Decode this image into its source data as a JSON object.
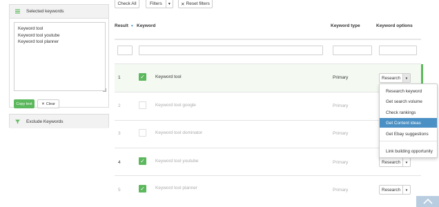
{
  "sidebar": {
    "selected_title": "Selected keywords",
    "selected_keywords_text": "Keyword tool\nKeyword tool youtube\nKeyword tool planner",
    "copy_label": "Copy text",
    "clear_label": "Clear",
    "exclude_title": "Exclude Keywords"
  },
  "toolbar": {
    "check_all": "Check All",
    "filters": "Filters",
    "reset_filters": "Reset filters"
  },
  "table": {
    "headers": {
      "result": "Result",
      "keyword": "Keyword",
      "keyword_type": "Keyword type",
      "keyword_options": "Keyword options"
    },
    "rows": [
      {
        "num": "1",
        "keyword": "Keyword tool",
        "type": "Primary",
        "checked": true
      },
      {
        "num": "2",
        "keyword": "Keyword tool google",
        "type": "Primary",
        "checked": false
      },
      {
        "num": "3",
        "keyword": "Keyword tool dominator",
        "type": "Primary",
        "checked": false
      },
      {
        "num": "4",
        "keyword": "Keyword tool youtube",
        "type": "Primary",
        "checked": true
      },
      {
        "num": "5",
        "keyword": "Keyword tool planner",
        "type": "Primary",
        "checked": true
      }
    ],
    "research_label": "Research"
  },
  "dropdown": {
    "items": [
      "Research keyword",
      "Get search volume",
      "Check rankings",
      "Get Content ideas",
      "Get Ebay suggestions",
      "Link building opportunity"
    ],
    "highlighted_index": 3
  },
  "colors": {
    "accent_green": "#5cb85c",
    "highlight_blue": "#4a90c4"
  }
}
